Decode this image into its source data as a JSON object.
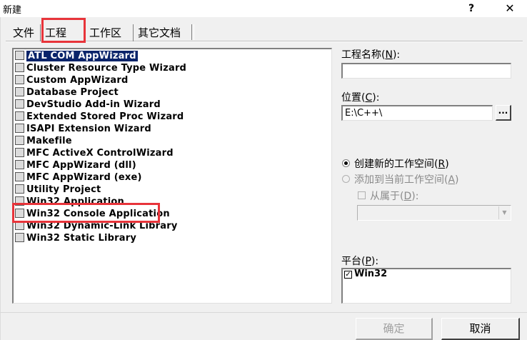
{
  "window": {
    "title": "新建",
    "help_label": "?",
    "close_label": "✕"
  },
  "tabs": [
    {
      "label": "文件"
    },
    {
      "label": "工程"
    },
    {
      "label": "工作区"
    },
    {
      "label": "其它文档"
    }
  ],
  "projects": [
    {
      "label": "ATL COM AppWizard",
      "selected": true
    },
    {
      "label": "Cluster Resource Type Wizard"
    },
    {
      "label": "Custom AppWizard"
    },
    {
      "label": "Database Project"
    },
    {
      "label": "DevStudio Add-in Wizard"
    },
    {
      "label": "Extended Stored Proc Wizard"
    },
    {
      "label": "ISAPI Extension Wizard"
    },
    {
      "label": "Makefile"
    },
    {
      "label": "MFC ActiveX ControlWizard"
    },
    {
      "label": "MFC AppWizard (dll)"
    },
    {
      "label": "MFC AppWizard (exe)"
    },
    {
      "label": "Utility Project"
    },
    {
      "label": "Win32 Application"
    },
    {
      "label": "Win32 Console Application"
    },
    {
      "label": "Win32 Dynamic-Link Library"
    },
    {
      "label": "Win32 Static Library"
    }
  ],
  "form": {
    "project_name_label": "工程名称",
    "project_name_key": "N",
    "project_name_value": "",
    "location_label": "位置",
    "location_key": "C",
    "location_value": "E:\\C++\\",
    "browse_label": "...",
    "radio_new_label": "创建新的工作空间",
    "radio_new_key": "R",
    "radio_add_label": "添加到当前工作空间",
    "radio_add_key": "A",
    "dependency_label": "从属于",
    "dependency_key": "D",
    "platform_label": "平台",
    "platform_key": "P",
    "platform_item": "Win32",
    "platform_check": "✓"
  },
  "buttons": {
    "ok": "确定",
    "cancel": "取消"
  },
  "colors": {
    "highlight_box": "#e8343a",
    "selection": "#0a246a"
  }
}
